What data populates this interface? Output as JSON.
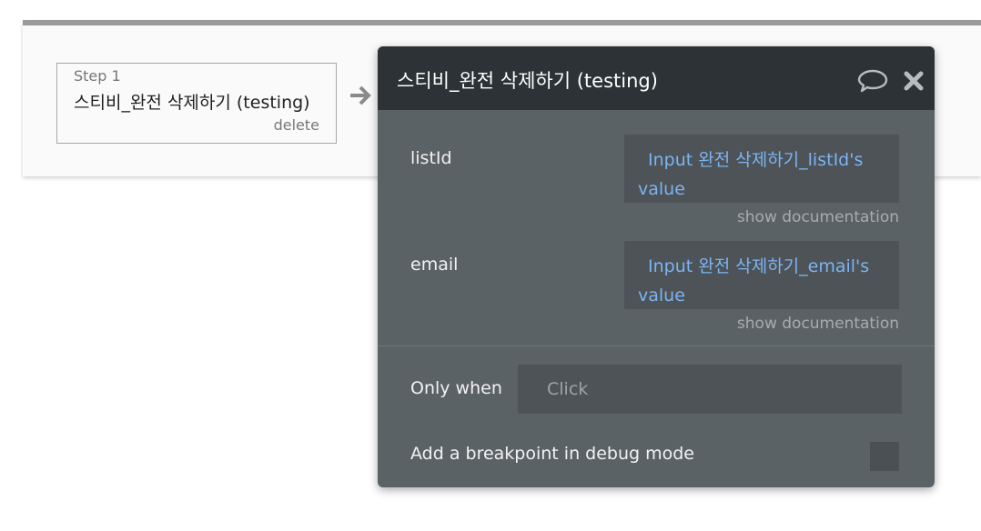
{
  "workflow": {
    "step_number": "Step 1",
    "step_title": "스티비_완전 삭제하기 (testing)",
    "delete_label": "delete"
  },
  "panel": {
    "title": "스티비_완전 삭제하기 (testing)",
    "fields": [
      {
        "label": "listId",
        "value": "Input 완전 삭제하기_listId's value",
        "doc_link": "show documentation"
      },
      {
        "label": "email",
        "value": "Input 완전 삭제하기_email's value",
        "doc_link": "show documentation"
      }
    ],
    "only_when_label": "Only when",
    "only_when_placeholder": "Click",
    "breakpoint_label": "Add a breakpoint in debug mode"
  },
  "colors": {
    "panel_bg": "#5b6265",
    "header_bg": "#2c3235",
    "link_blue": "#7cb4f2"
  },
  "icons": [
    "arrow-right-icon",
    "comment-icon",
    "close-icon"
  ]
}
